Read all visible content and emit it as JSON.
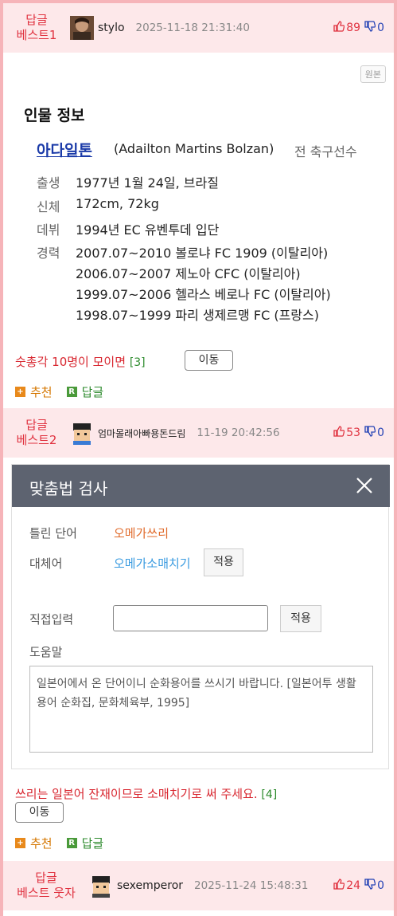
{
  "posts": [
    {
      "badge": "답글\n베스트1",
      "author": "stylo",
      "date": "2025-11-18 21:31:40",
      "up": "89",
      "down": "0",
      "comment": "숫총각 10명이 모이면",
      "reply_count": "[3]",
      "move": "이동",
      "recommend": "추천",
      "reply": "답글"
    },
    {
      "badge": "답글\n베스트2",
      "author": "엄마몰래아빠용돈드림",
      "date": "11-19 20:42:56",
      "up": "53",
      "down": "0",
      "comment": "쓰리는 일본어 잔재이므로 소매치기로 써 주세요.",
      "reply_count": "[4]",
      "move": "이동",
      "recommend": "추천",
      "reply": "답글"
    },
    {
      "badge": "답글\n베스트 웃자",
      "author": "sexemperor",
      "date": "2025-11-24 15:48:31",
      "up": "24",
      "down": "0"
    }
  ],
  "profile": {
    "original_button": "원본",
    "title": "인물 정보",
    "name": "아다일톤",
    "roman": "(Adailton Martins Bolzan)",
    "job": "전 축구선수",
    "rows": [
      {
        "label": "출생",
        "value": "1977년 1월 24일, 브라질"
      },
      {
        "label": "신체",
        "value": "172cm, 72kg"
      },
      {
        "label": "데뷔",
        "value": "1994년 EC 유벤투데 입단"
      },
      {
        "label": "경력",
        "value": "2007.07~2010 볼로냐 FC 1909 (이탈리아)"
      },
      {
        "label": "",
        "value": "2006.07~2007 제노아 CFC (이탈리아)"
      },
      {
        "label": "",
        "value": "1999.07~2006 헬라스 베로나 FC (이탈리아)"
      },
      {
        "label": "",
        "value": "1998.07~1999 파리 생제르맹 FC (프랑스)"
      }
    ]
  },
  "spellcheck": {
    "title": "맞춤법 검사",
    "wrong_label": "틀린 단어",
    "wrong_word": "오메가쓰리",
    "sub_label": "대체어",
    "sub_word": "오메가소매치기",
    "apply": "적용",
    "direct_label": "직접입력",
    "direct_value": "",
    "help_label": "도움말",
    "help_text": "일본어에서 온 단어이니 순화용어를 쓰시기 바랍니다. [일본어투 생활용어 순화집, 문화체육부, 1995]"
  },
  "colors": {
    "frame": "#f6b4b9",
    "header_bg": "#fde8ea",
    "accent_red": "#e0313f",
    "down_blue": "#2341b5",
    "dialog_header": "#5d6370"
  }
}
